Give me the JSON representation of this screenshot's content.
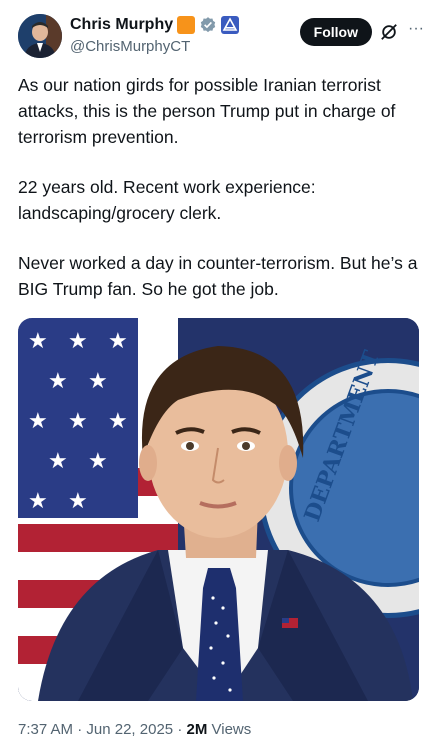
{
  "author": {
    "display_name": "Chris Murphy",
    "handle": "@ChrisMurphyCT",
    "avatar_icon": "profile-photo",
    "badges": [
      "orange-square-icon",
      "verified-badge-icon",
      "government-badge-icon"
    ]
  },
  "header": {
    "follow_label": "Follow",
    "grok_icon": "grok-icon",
    "more_icon": "more-options-icon"
  },
  "tweet": {
    "paragraphs": [
      "As our nation girds for possible Iranian terrorist attacks, this is the person Trump put in charge of terrorism prevention.",
      "22 years old. Recent work experience:\nlandscaping/grocery clerk.",
      "Never worked a day in counter-terrorism. But he’s a BIG Trump fan. So he got the job."
    ]
  },
  "media": {
    "seal_text": "DEPARTMENT"
  },
  "footer": {
    "time": "7:37 AM",
    "separator": "·",
    "date": "Jun 22, 2025",
    "views_count": "2M",
    "views_label": "Views"
  },
  "colors": {
    "text": "#0f1419",
    "secondary": "#536471",
    "verified_blue": "#1d9bf0",
    "org_orange": "#f7931a"
  }
}
